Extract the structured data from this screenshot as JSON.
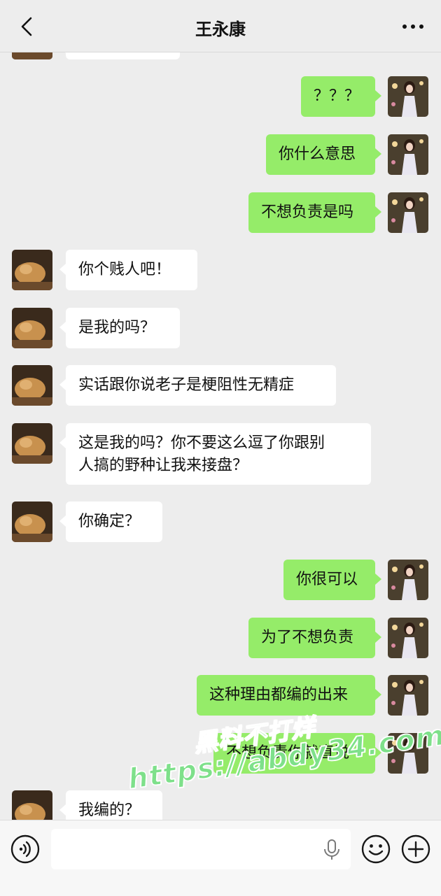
{
  "header": {
    "title": "王永康"
  },
  "messages": [
    {
      "side": "in",
      "text": ""
    },
    {
      "side": "out",
      "text": "？？？"
    },
    {
      "side": "out",
      "text": "你什么意思"
    },
    {
      "side": "out",
      "text": "不想负责是吗"
    },
    {
      "side": "in",
      "text": "你个贱人吧！"
    },
    {
      "side": "in",
      "text": "是我的吗？"
    },
    {
      "side": "in",
      "text": "实话跟你说老子是梗阻性无精症"
    },
    {
      "side": "in",
      "text": "这是我的吗？你不要这么逗了你跟别\n人搞的野种让我来接盘？"
    },
    {
      "side": "in",
      "text": "你确定？"
    },
    {
      "side": "out",
      "text": "你很可以"
    },
    {
      "side": "out",
      "text": "为了不想负责"
    },
    {
      "side": "out",
      "text": "这种理由都编的出来"
    },
    {
      "side": "out",
      "text": "不想负责你就直说"
    },
    {
      "side": "in",
      "text": "我编的？"
    }
  ],
  "watermark": {
    "line1": "黑料不打烊",
    "line2": "https://abdy34.com"
  },
  "input": {
    "value": ""
  },
  "icons": {
    "back": "chevron-left-icon",
    "more": "more-dots-icon",
    "voice": "voice-icon",
    "mic": "mic-icon",
    "emoji": "emoji-icon",
    "plus": "plus-icon"
  },
  "colors": {
    "outgoing_bubble": "#95ec69",
    "incoming_bubble": "#ffffff",
    "background": "#ededed"
  }
}
